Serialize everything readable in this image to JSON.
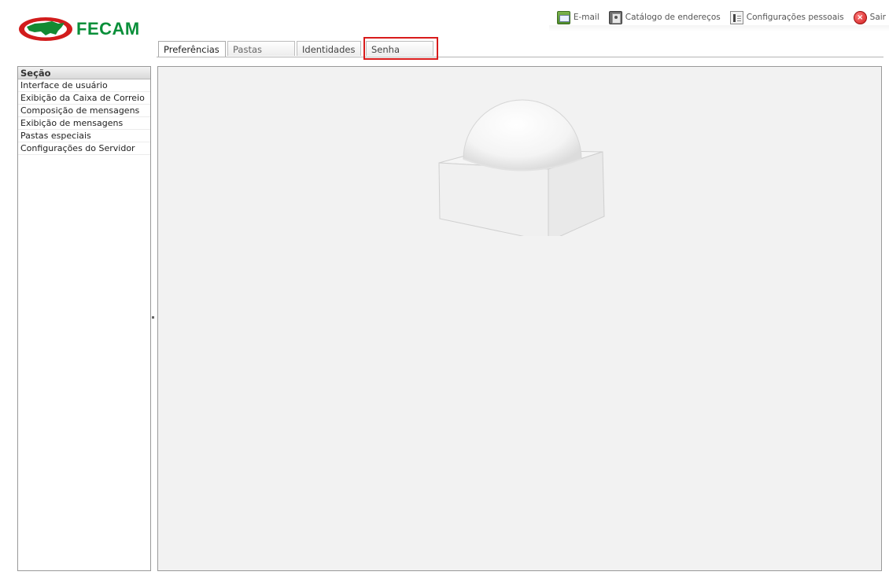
{
  "brand": {
    "name": "FECAM",
    "color": "#0a8f3a"
  },
  "taskbar": {
    "items": [
      {
        "label": "E-mail",
        "icon": "mail-icon"
      },
      {
        "label": "Catálogo de endereços",
        "icon": "address-book-icon"
      },
      {
        "label": "Configurações pessoais",
        "icon": "settings-icon"
      },
      {
        "label": "Sair",
        "icon": "exit-icon"
      }
    ]
  },
  "tabs": {
    "items": [
      {
        "label": "Preferências",
        "active": true
      },
      {
        "label": "Pastas",
        "active": false
      },
      {
        "label": "Identidades",
        "active": false
      },
      {
        "label": "Senha",
        "active": false,
        "highlighted": true
      }
    ]
  },
  "sections": {
    "header": "Seção",
    "items": [
      "Interface de usuário",
      "Exibição da Caixa de Correio",
      "Composição de mensagens",
      "Exibição de mensagens",
      "Pastas especiais",
      "Configurações do Servidor"
    ]
  },
  "colors": {
    "highlight": "#d81b1b",
    "content_background": "#f2f2f2"
  }
}
